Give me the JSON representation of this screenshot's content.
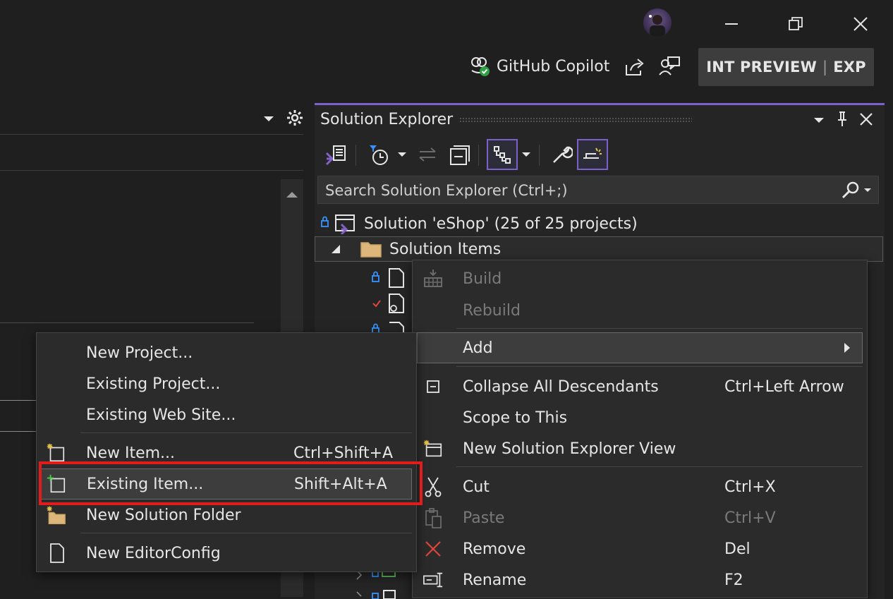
{
  "titlebar": {
    "minimize_icon": "minimize-icon",
    "restore_icon": "restore-icon",
    "close_icon": "close-icon",
    "copilot_label": "GitHub Copilot",
    "badge_left": "INT PREVIEW",
    "badge_sep": "|",
    "badge_right": "EXP"
  },
  "solution_explorer": {
    "title": "Solution Explorer",
    "search_placeholder": "Search Solution Explorer (Ctrl+;)",
    "tree": {
      "solution_label": "Solution 'eShop' (25 of 25 projects)",
      "folder_label": "Solution Items"
    }
  },
  "context_menu": {
    "items": [
      {
        "label": "Build",
        "shortcut": ""
      },
      {
        "label": "Rebuild",
        "shortcut": ""
      },
      {
        "label": "Add",
        "shortcut": ""
      },
      {
        "label": "Collapse All Descendants",
        "shortcut": "Ctrl+Left Arrow"
      },
      {
        "label": "Scope to This",
        "shortcut": ""
      },
      {
        "label": "New Solution Explorer View",
        "shortcut": ""
      },
      {
        "label": "Cut",
        "shortcut": "Ctrl+X"
      },
      {
        "label": "Paste",
        "shortcut": "Ctrl+V"
      },
      {
        "label": "Remove",
        "shortcut": "Del"
      },
      {
        "label": "Rename",
        "shortcut": "F2"
      }
    ]
  },
  "add_submenu": {
    "items": [
      {
        "label": "New Project...",
        "shortcut": ""
      },
      {
        "label": "Existing Project...",
        "shortcut": ""
      },
      {
        "label": "Existing Web Site...",
        "shortcut": ""
      },
      {
        "label": "New Item...",
        "shortcut": "Ctrl+Shift+A"
      },
      {
        "label": "Existing Item...",
        "shortcut": "Shift+Alt+A"
      },
      {
        "label": "New Solution Folder",
        "shortcut": ""
      },
      {
        "label": "New EditorConfig",
        "shortcut": ""
      }
    ]
  },
  "colors": {
    "accent": "#7b61c9",
    "highlight_box": "#e21b1b",
    "remove_icon": "#e0443a"
  }
}
